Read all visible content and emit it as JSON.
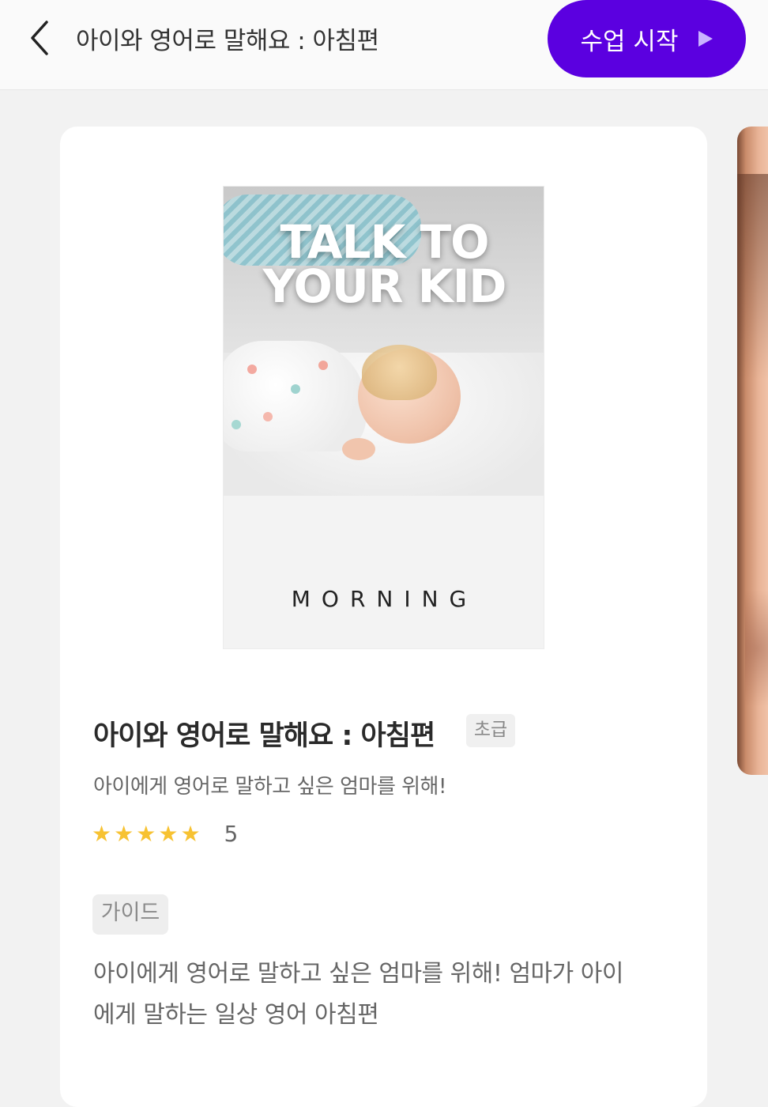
{
  "header": {
    "title": "아이와 영어로 말해요 : 아침편",
    "start_button_label": "수업 시작"
  },
  "course": {
    "cover_title_line1": "TALK TO",
    "cover_title_line2": "YOUR KID",
    "cover_subtitle": "MORNING",
    "title": "아이와 영어로 말해요 : 아침편",
    "level": "초급",
    "subtitle": "아이에게 영어로 말하고 싶은 엄마를 위해!",
    "rating": 5,
    "rating_label": "5",
    "guide_label": "가이드",
    "description": "아이에게 영어로 말하고 싶은 엄마를 위해! 엄마가 아이에게 말하는 일상 영어 아침편"
  },
  "colors": {
    "accent": "#5b00e0",
    "star": "#f7c232"
  }
}
